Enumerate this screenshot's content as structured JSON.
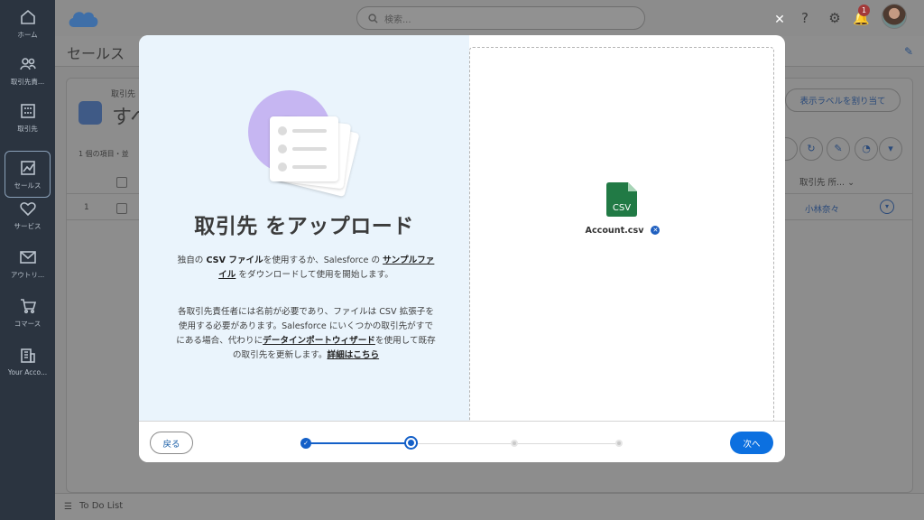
{
  "sidebar": {
    "items": [
      {
        "label": "ホーム",
        "icon": "home-icon"
      },
      {
        "label": "取引先責...",
        "icon": "contacts-icon"
      },
      {
        "label": "取引先",
        "icon": "building-icon"
      },
      {
        "label": "セールス",
        "icon": "sales-chart-icon",
        "active": true
      },
      {
        "label": "サービス",
        "icon": "heart-icon"
      },
      {
        "label": "アウトリ...",
        "icon": "envelope-icon"
      },
      {
        "label": "コマース",
        "icon": "cart-icon"
      },
      {
        "label": "Your Acco...",
        "icon": "accounts-icon"
      }
    ]
  },
  "topbar": {
    "search_placeholder": "検索...",
    "notification_count": "1"
  },
  "page": {
    "title": "セールス",
    "list_object": "取引先",
    "list_name": "すべ",
    "item_count": "1 個の項目・並",
    "assign_label_button": "表示ラベルを割り当て",
    "column_owner": "取引先 所...",
    "row_number": "1",
    "row_owner": "小林奈々"
  },
  "todo": {
    "label": "To Do List"
  },
  "modal": {
    "title": "取引先 をアップロード",
    "para1": {
      "p1": "独自の ",
      "csv_file": "CSV ファイル",
      "p2": "を使用するか、Salesforce の ",
      "sample_link": "サンプルファイル",
      "p3": " をダウンロードして使用を開始します。"
    },
    "para2": {
      "p1": "各取引先責任者には名前が必要であり、ファイルは CSV 拡張子を使用する必要があります。Salesforce にいくつかの取引先がすでにある場合、代わりに",
      "wizard_link": "データインポートウィザード",
      "p2": "を使用して既存の取引先を更新します。",
      "details_link": "詳細はこちら"
    },
    "file": {
      "name": "Account.csv",
      "type_label": "CSV",
      "color": "#217a45"
    },
    "footer": {
      "back_label": "戻る",
      "next_label": "次へ",
      "total_steps": 4,
      "current_step": 2
    }
  },
  "colors": {
    "accent": "#0c70e0",
    "panel_bg": "#eaf4fc",
    "illustration": "#c6b6f2"
  }
}
